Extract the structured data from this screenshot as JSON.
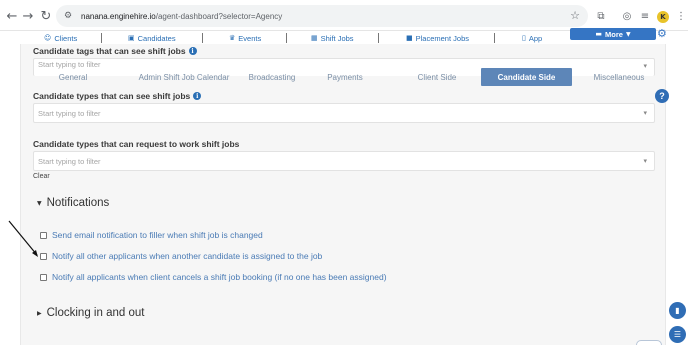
{
  "browser": {
    "url_host": "nanana.enginehire.io",
    "url_path": "/agent-dashboard?selector=Agency",
    "avatar_letter": "K"
  },
  "appnav": {
    "items": [
      {
        "label": "Clients",
        "icon": "clients-icon"
      },
      {
        "label": "Candidates",
        "icon": "candidates-icon"
      },
      {
        "label": "Events",
        "icon": "trophy-icon"
      },
      {
        "label": "Shift Jobs",
        "icon": "calendar-icon"
      },
      {
        "label": "Placement Jobs",
        "icon": "briefcase-icon"
      },
      {
        "label": "App",
        "icon": "phone-icon"
      }
    ],
    "more_label": "More"
  },
  "section_tags": {
    "label": "Candidate tags that can see shift jobs",
    "placeholder": "Start typing to filter"
  },
  "tabs": [
    {
      "label": "General",
      "active": false
    },
    {
      "label": "Admin Shift Job Calendar",
      "active": false
    },
    {
      "label": "Broadcasting",
      "active": false
    },
    {
      "label": "Payments",
      "active": false
    },
    {
      "label": "Client Side",
      "active": false
    },
    {
      "label": "Candidate Side",
      "active": true
    },
    {
      "label": "Miscellaneous",
      "active": false
    }
  ],
  "section_types_see": {
    "label": "Candidate types that can see shift jobs",
    "placeholder": "Start typing to filter"
  },
  "section_types_request": {
    "label": "Candidate types that can request to work shift jobs",
    "placeholder": "Start typing to filter"
  },
  "clear_label": "Clear",
  "notifications": {
    "title": "Notifications",
    "options": [
      {
        "label": "Send email notification to filler when shift job is changed",
        "checked": false
      },
      {
        "label": "Notify all other applicants when another candidate is assigned to the job",
        "checked": false
      },
      {
        "label": "Notify all applicants when client cancels a shift job booking (if no one has been assigned)",
        "checked": false
      }
    ]
  },
  "clocking": {
    "title": "Clocking in and out"
  },
  "help_label": "?",
  "colors": {
    "accent": "#3575c4",
    "active_tab": "#5d86b8",
    "link": "#4a7bb5"
  }
}
